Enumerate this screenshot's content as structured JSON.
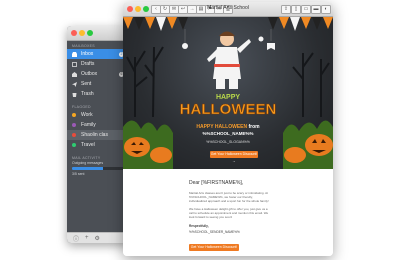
{
  "front_window": {
    "title": "Martial Arts School",
    "toolbar_icons": [
      "back-icon",
      "reload-icon",
      "mail-icon",
      "reply-icon",
      "forward-icon",
      "archive-icon",
      "flag-icon",
      "trash-icon",
      "print-icon",
      "share-icon",
      "mobile-icon",
      "tablet-icon",
      "desktop-icon",
      "contrast-icon"
    ]
  },
  "hero": {
    "banner_title_1": "HAPPY",
    "banner_title_2": "HALLOWEEN",
    "headline_prefix": "HAPPY HALLOWEEN",
    "headline_suffix": "from",
    "headline_name": "%%SCHOOL_NAME%%",
    "code": "%%SCHOOL_SLOGAN%%",
    "cta": "Get Your Halloween Discount! →"
  },
  "letter": {
    "greeting": "Dear [%FIRSTNAME%],",
    "para1": "Martial Arts classes aren't just to be scary or intimidating. At %%SCHOOL_NAME%%, we foster our friendly, individualized approach and a sport fun for the whole family!",
    "para2": "We have a Halloween delight gift to offer you, just give us a call to schedule an appointment and mention this email. We look forward to seeing you soon!",
    "sign1": "Respectfully,",
    "sign2": "%%SCHOOL_SENDER_NAME%%",
    "cta": "Get Your Halloween Discount! →"
  },
  "sidebar": {
    "mailboxes_label": "MAILBOXES",
    "mailboxes": [
      {
        "label": "Inbox",
        "icon": "inbox-icon",
        "badge": "2",
        "active": true
      },
      {
        "label": "Drafts",
        "icon": "drafts-icon",
        "badge": "",
        "active": false
      },
      {
        "label": "Outbox",
        "icon": "outbox-icon",
        "badge": "6",
        "active": false
      },
      {
        "label": "Sent",
        "icon": "sent-icon",
        "badge": "",
        "active": false
      },
      {
        "label": "Trash",
        "icon": "trash-icon",
        "badge": "",
        "active": false
      }
    ],
    "flagged_label": "FLAGGED",
    "flagged": [
      {
        "label": "Work",
        "color": "#f5a623"
      },
      {
        "label": "Family",
        "color": "#9b59b6"
      },
      {
        "label": "Shaolin clas",
        "color": "#e74c3c"
      },
      {
        "label": "Travel",
        "color": "#2ecc71"
      }
    ],
    "activity_label": "MAIL ACTIVITY",
    "activity_text": "Outgoing messages",
    "activity_count": "3/5 sent",
    "activity_progress": 0.6
  },
  "colors": {
    "accent": "#3a8ee6",
    "orange": "#ef7a22",
    "sidebar_bg": "#4b4f55"
  }
}
